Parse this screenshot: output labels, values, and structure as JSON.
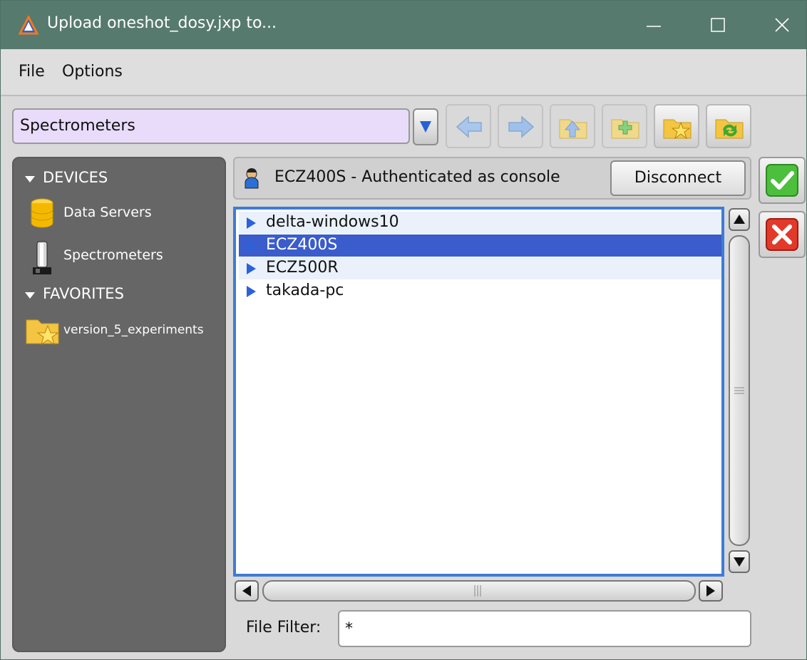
{
  "window": {
    "title": "Upload oneshot_dosy.jxp to..."
  },
  "menu": [
    "File",
    "Options"
  ],
  "toolbar": {
    "location": "Spectrometers",
    "buttons": [
      "dropdown-arrow-icon",
      "back-arrow-icon",
      "forward-arrow-icon",
      "folder-up-icon",
      "new-folder-icon",
      "favorite-folder-icon",
      "refresh-folder-icon"
    ]
  },
  "sidebar": {
    "devices_header": "DEVICES",
    "devices": [
      {
        "label": "Data Servers",
        "icon": "database-icon"
      },
      {
        "label": "Spectrometers",
        "icon": "spectrometer-icon"
      }
    ],
    "favorites_header": "FAVORITES",
    "favorites": [
      {
        "label": "version_5_experiments",
        "icon": "favorite-folder-icon"
      }
    ]
  },
  "status": {
    "text": "ECZ400S - Authenticated as console",
    "disconnect_label": "Disconnect",
    "icon": "user-icon"
  },
  "list": {
    "items": [
      {
        "label": "delta-windows10",
        "selected": false
      },
      {
        "label": "ECZ400S",
        "selected": true
      },
      {
        "label": "ECZ500R",
        "selected": false
      },
      {
        "label": "takada-pc",
        "selected": false
      }
    ]
  },
  "file_filter": {
    "label": "File Filter:",
    "value": "*"
  },
  "colors": {
    "titlebar": "#577a6e",
    "selection": "#3a5ccc",
    "location_bg": "#e9dcfb",
    "sidebar": "#666666"
  }
}
